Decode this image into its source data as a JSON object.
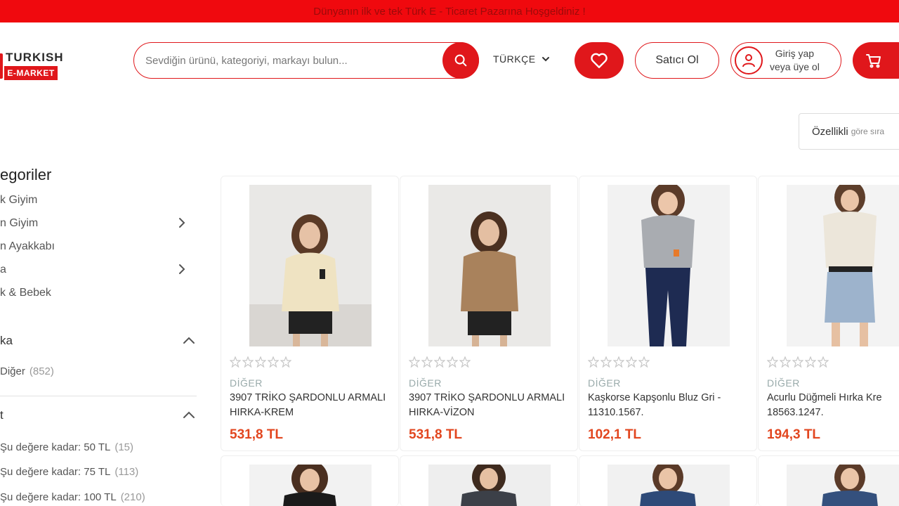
{
  "banner": {
    "text": "Dünyanın ilk ve tek Türk E - Ticaret Pazarına Hoşgeldiniz !"
  },
  "logo": {
    "line1": "TURKISH",
    "line2": "E-MARKET"
  },
  "search": {
    "placeholder": "Sevdiğin ürünü, kategoriyi, markayı bulun..."
  },
  "language": {
    "selected": "TÜRKÇE"
  },
  "header": {
    "seller_label": "Satıcı Ol",
    "login_line1": "Giriş yap",
    "login_line2": "veya üye ol"
  },
  "sort": {
    "label": "Özellikli",
    "sub": "göre sıra"
  },
  "sidebar": {
    "categories_title": "egoriler",
    "categories": [
      {
        "label": "k Giyim",
        "has_submenu": false
      },
      {
        "label": "n Giyim",
        "has_submenu": true
      },
      {
        "label": "n Ayakkabı",
        "has_submenu": false
      },
      {
        "label": "a",
        "has_submenu": true
      },
      {
        "label": "k & Bebek",
        "has_submenu": false
      }
    ],
    "brand_section": {
      "title": "ka",
      "items": [
        {
          "label": "Diğer",
          "count": "(852)"
        }
      ]
    },
    "price_section": {
      "title": "t",
      "items": [
        {
          "label": "Şu değere kadar: 50 TL",
          "count": "(15)"
        },
        {
          "label": "Şu değere kadar: 75 TL",
          "count": "(113)"
        },
        {
          "label": "Şu değere kadar: 100 TL",
          "count": "(210)"
        }
      ]
    }
  },
  "products": [
    {
      "brand": "DİĞER",
      "name": "3907 TRİKO ŞARDONLU ARMALI HIRKA-KREM",
      "price": "531,8 TL"
    },
    {
      "brand": "DİĞER",
      "name": "3907 TRİKO ŞARDONLU ARMALI HIRKA-VİZON",
      "price": "531,8 TL"
    },
    {
      "brand": "DİĞER",
      "name": "Kaşkorse Kapşonlu Bluz Gri - 11310.1567.",
      "price": "102,1 TL"
    },
    {
      "brand": "DİĞER",
      "name": "Acurlu Düğmeli Hırka Kre 18563.1247.",
      "price": "194,3 TL"
    }
  ],
  "colors": {
    "accent": "#e0171b",
    "price": "#e2461f",
    "banner_bg": "#f0090e"
  },
  "icons": [
    "search-icon",
    "chevron-down-icon",
    "heart-icon",
    "user-icon",
    "cart-icon",
    "chevron-right-icon",
    "chevron-up-icon",
    "star-icon"
  ]
}
